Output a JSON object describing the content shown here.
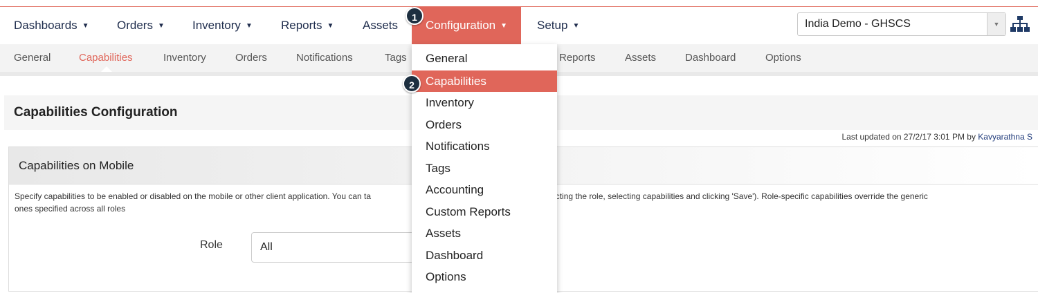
{
  "main_nav": {
    "items": [
      {
        "label": "Dashboards",
        "has_caret": true
      },
      {
        "label": "Orders",
        "has_caret": true
      },
      {
        "label": "Inventory",
        "has_caret": true
      },
      {
        "label": "Reports",
        "has_caret": true
      },
      {
        "label": "Assets",
        "has_caret": false
      },
      {
        "label": "Configuration",
        "has_caret": true,
        "active": true
      },
      {
        "label": "Setup",
        "has_caret": true
      }
    ],
    "caret": "▼",
    "domain_selector": {
      "value": "India Demo - GHSCS",
      "arrow": "▼"
    },
    "hierarchy_icon": "sitemap-icon"
  },
  "badges": {
    "step1": "1",
    "step2": "2"
  },
  "sub_nav": {
    "items": [
      {
        "label": "General"
      },
      {
        "label": "Capabilities",
        "active": true
      },
      {
        "label": "Inventory"
      },
      {
        "label": "Orders"
      },
      {
        "label": "Notifications"
      },
      {
        "label": "Tags"
      },
      {
        "label": "Reports"
      },
      {
        "label": "Assets"
      },
      {
        "label": "Dashboard"
      },
      {
        "label": "Options"
      }
    ]
  },
  "page": {
    "title": "Capabilities Configuration",
    "last_updated_prefix": "Last updated on 27/2/17 3:01 PM by ",
    "last_updated_user": "Kavyarathna S"
  },
  "panel": {
    "title": "Capabilities on Mobile",
    "description_left": "Specify capabilities to be enabled or disabled on the mobile or other client application. You can ta",
    "description_right": "first selecting the role, selecting capabilities and clicking 'Save'). Role-specific capabilities override the generic",
    "description_line2": "ones specified across all roles",
    "role_label": "Role",
    "role_value": "All"
  },
  "dropdown": {
    "items": [
      {
        "label": "General"
      },
      {
        "label": "Capabilities",
        "active": true
      },
      {
        "label": "Inventory"
      },
      {
        "label": "Orders"
      },
      {
        "label": "Notifications"
      },
      {
        "label": "Tags"
      },
      {
        "label": "Accounting"
      },
      {
        "label": "Custom Reports"
      },
      {
        "label": "Assets"
      },
      {
        "label": "Dashboard"
      },
      {
        "label": "Options"
      }
    ]
  },
  "colors": {
    "accent": "#e0665a",
    "nav_text": "#1f2d4d",
    "badge_bg": "#1d2f40"
  }
}
